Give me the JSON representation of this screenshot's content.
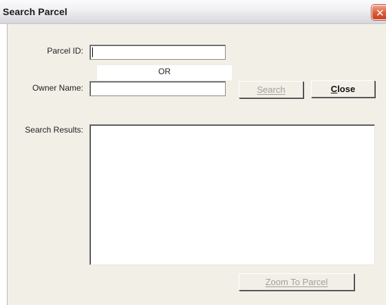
{
  "window": {
    "title": "Search Parcel",
    "close_glyph": "✕"
  },
  "form": {
    "parcel_id_label": "Parcel ID:",
    "parcel_id_value": "",
    "or_text": "OR",
    "owner_name_label": "Owner Name:",
    "owner_name_value": "",
    "search_results_label": "Search Results:"
  },
  "buttons": {
    "search_label": "Search",
    "close_mnemonic": "C",
    "close_rest": "lose",
    "zoom_label": "Zoom To Parcel"
  },
  "colors": {
    "titlebar": "#e4e4e8",
    "client_background": "#f1efe6",
    "close_button": "#e0603e",
    "disabled_text": "#a19f97"
  },
  "icons": {
    "close": "close-icon"
  }
}
